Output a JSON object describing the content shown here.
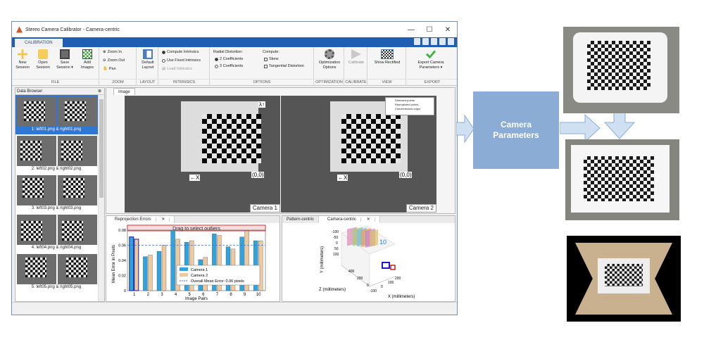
{
  "window": {
    "title": "Stereo Camera Calibrator - Camera-centric",
    "controls": [
      "—",
      "☐",
      "✕"
    ]
  },
  "ribbon": {
    "tab": "CALIBRATION",
    "file": {
      "label": "FILE",
      "new_session": "New Session",
      "open_session": "Open Session",
      "save_session": "Save Session ▾",
      "add_images": "Add Images"
    },
    "zoom": {
      "label": "ZOOM",
      "zoom_in": "Zoom In",
      "zoom_out": "Zoom Out",
      "pan": "Pan"
    },
    "layout": {
      "label": "LAYOUT",
      "default_layout": "Default Layout"
    },
    "intrinsics": {
      "label": "INTRINSICS",
      "compute": "Compute Intrinsics",
      "use_fixed": "Use Fixed Intrinsics",
      "load": "Load Intrinsics"
    },
    "options": {
      "label": "OPTIONS",
      "radial_title": "Radial Distortion:",
      "two_coeff": "2 Coefficients",
      "three_coeff": "3 Coefficients",
      "compute_title": "Compute:",
      "skew": "Skew",
      "tangential": "Tangential Distortion"
    },
    "optimization": {
      "label": "OPTIMIZATION",
      "button": "Optimization Options"
    },
    "calibrate": {
      "label": "CALIBRATE",
      "button": "Calibrate"
    },
    "view": {
      "label": "VIEW",
      "button": "Show Rectified"
    },
    "export": {
      "label": "EXPORT",
      "button": "Export Camera Parameters ▾"
    }
  },
  "data_browser": {
    "title": "Data Browser",
    "items": [
      "1: left01.png & right01.png",
      "2: left02.png & right02.png",
      "3: left03.png & right03.png",
      "4: left04.png & right04.png",
      "5: left05.png & right05.png"
    ]
  },
  "image_panel": {
    "tab": "Image",
    "camera1": "Camera 1",
    "camera2": "Camera 2",
    "y_axis": "λ↑",
    "x_axis": "←X",
    "origin": "(0,0)",
    "legend": [
      "Detected points",
      "Reprojected points",
      "Checkerboard origin"
    ]
  },
  "reprojection_panel": {
    "tab": "Reprojection Errors",
    "drag_text": "Drag to select outliers",
    "ylabel": "Mean Error in Pixels",
    "xlabel": "Image Pairs",
    "legend": {
      "cam1": "Camera 1",
      "cam2": "Camera 2",
      "mean": "Overall Mean Error: 0.06 pixels"
    }
  },
  "extrinsics_panel": {
    "tabs": [
      "Pattern-centric",
      "Camera-centric"
    ],
    "ylabel": "Y (millimeters)",
    "zlabel": "Z (millimeters)",
    "xlabel": "X (millimeters)",
    "y_ticks": [
      "-100",
      "-50",
      "0",
      "50",
      "100"
    ],
    "z_ticks": [
      "400",
      "200",
      "0"
    ],
    "x_ticks": [
      "-100",
      "0",
      "100",
      "200"
    ],
    "label10": "10"
  },
  "diagram": {
    "box_label": "Camera Parameters"
  },
  "chart_data": {
    "type": "bar",
    "categories": [
      "1",
      "2",
      "3",
      "4",
      "5",
      "6",
      "7",
      "8",
      "9",
      "10"
    ],
    "series": [
      {
        "name": "Camera 1",
        "values": [
          0.071,
          0.045,
          0.052,
          0.08,
          0.064,
          0.041,
          0.075,
          0.058,
          0.071,
          0.066
        ],
        "color": "#2fa3de"
      },
      {
        "name": "Camera 2",
        "values": [
          0.068,
          0.047,
          0.06,
          0.068,
          0.066,
          0.044,
          0.073,
          0.055,
          0.079,
          0.066
        ],
        "color": "#eec9a0"
      }
    ],
    "mean": 0.06,
    "ylim": [
      0,
      0.08
    ],
    "yticks": [
      "0",
      "0.02",
      "0.04",
      "0.06",
      "0.08"
    ],
    "xlabel": "Image Pairs",
    "ylabel": "Mean Error in Pixels"
  }
}
